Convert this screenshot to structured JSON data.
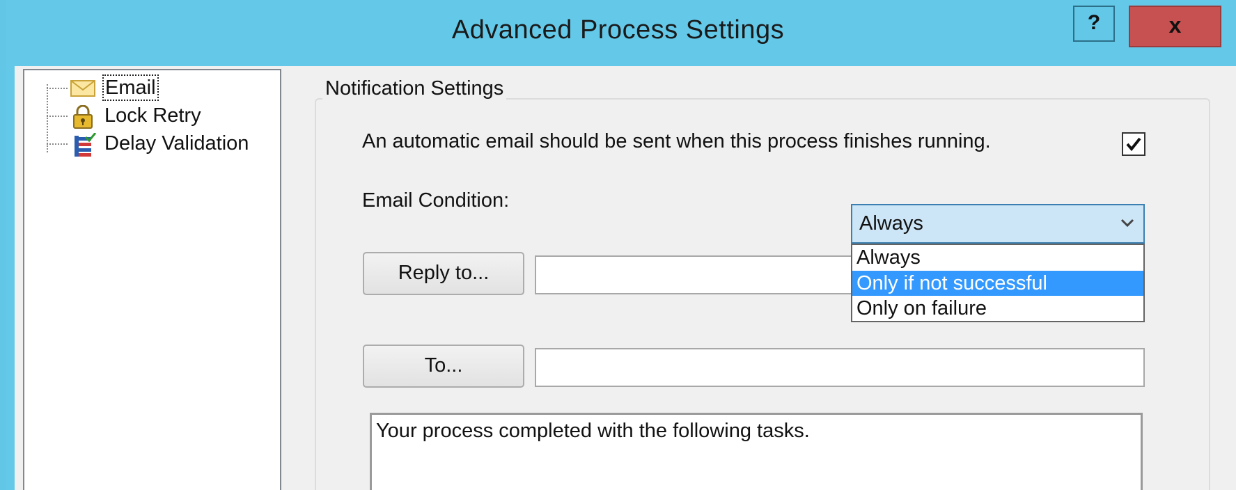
{
  "window": {
    "title": "Advanced Process Settings",
    "help_label": "?",
    "close_label": "x"
  },
  "tree": {
    "items": [
      {
        "label": "Email",
        "icon": "envelope-icon",
        "focused": true
      },
      {
        "label": "Lock Retry",
        "icon": "padlock-icon",
        "focused": false
      },
      {
        "label": "Delay Validation",
        "icon": "list-check-icon",
        "focused": false
      }
    ]
  },
  "notification": {
    "group_title": "Notification Settings",
    "auto_email_text": "An automatic email should be sent when this process finishes running.",
    "auto_email_checked": true,
    "condition_label": "Email Condition:",
    "condition_value": "Always",
    "condition_options": [
      "Always",
      "Only if not successful",
      "Only on failure"
    ],
    "highlighted_option": "Only if not successful",
    "reply_to_button": "Reply to...",
    "reply_to_value": "",
    "to_button": "To...",
    "to_value": "",
    "body_text": "Your process completed with the following tasks."
  },
  "colors": {
    "titlebar": "#64c9e9",
    "close_button": "#c75050",
    "selection": "#3399ff",
    "combo_focus": "#cde6f7"
  }
}
